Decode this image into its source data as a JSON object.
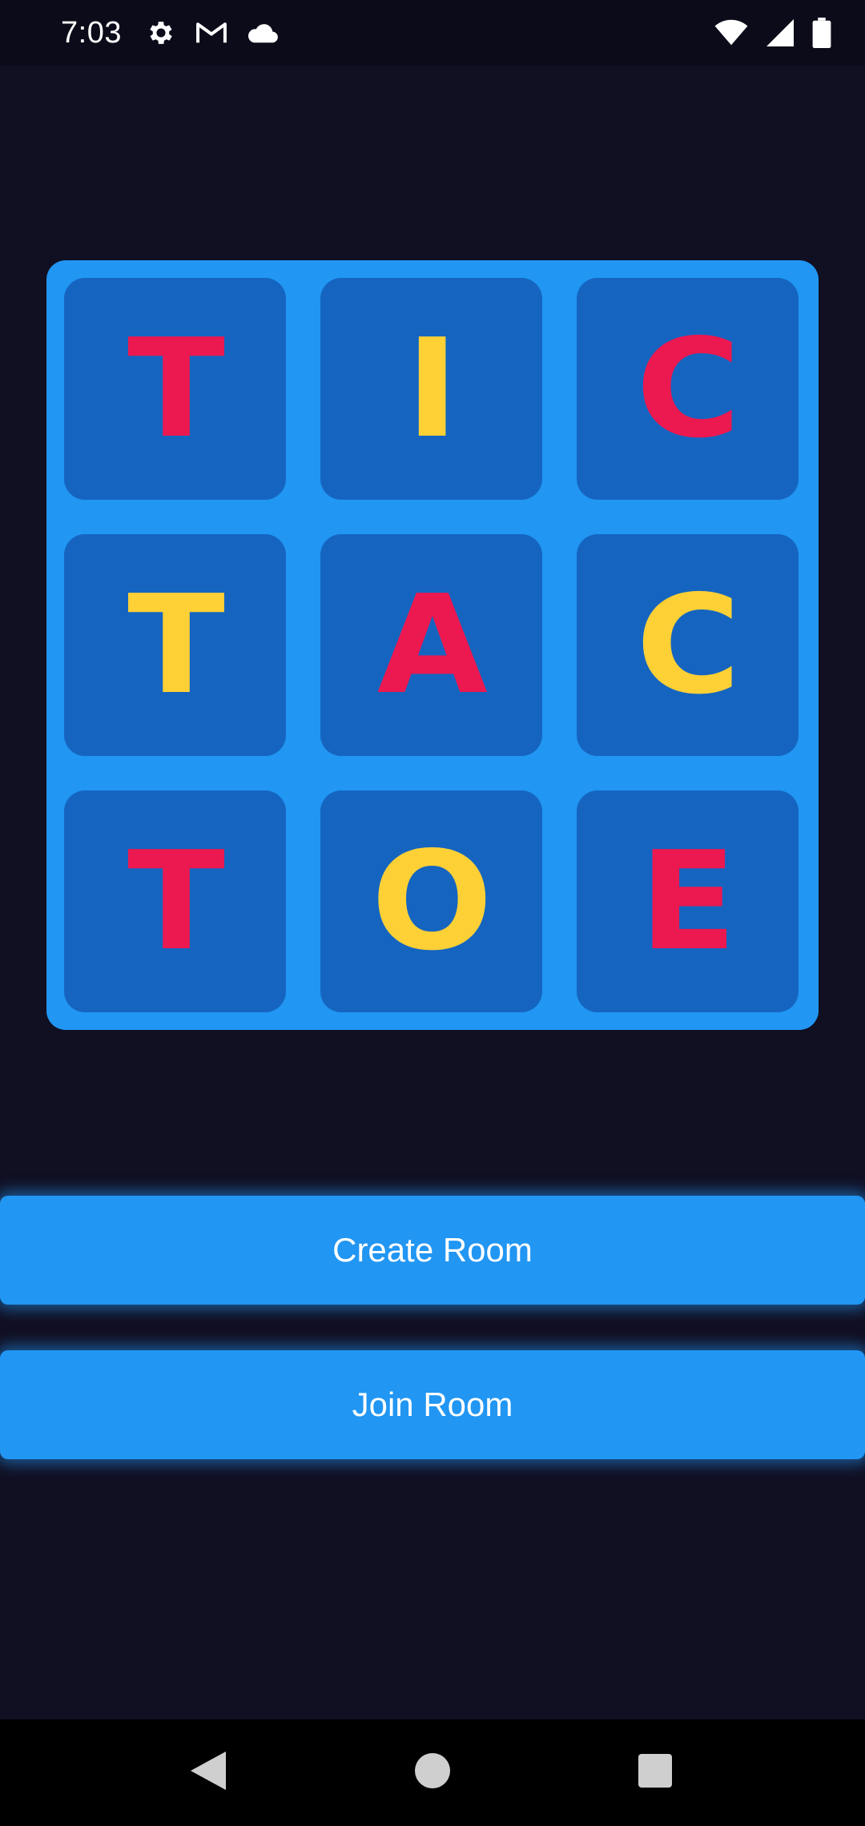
{
  "status_bar": {
    "time": "7:03",
    "left_icons": [
      "gear-icon",
      "gmail-icon",
      "cloud-icon"
    ],
    "right_icons": [
      "wifi-icon",
      "signal-icon",
      "battery-icon"
    ]
  },
  "board": {
    "cells": [
      {
        "letter": "T",
        "color": "#ec1850"
      },
      {
        "letter": "I",
        "color": "#fdd036"
      },
      {
        "letter": "C",
        "color": "#ec1850"
      },
      {
        "letter": "T",
        "color": "#fdd036"
      },
      {
        "letter": "A",
        "color": "#ec1850"
      },
      {
        "letter": "C",
        "color": "#fdd036"
      },
      {
        "letter": "T",
        "color": "#ec1850"
      },
      {
        "letter": "O",
        "color": "#fdd036"
      },
      {
        "letter": "E",
        "color": "#ec1850"
      }
    ]
  },
  "actions": {
    "create_room_label": "Create Room",
    "join_room_label": "Join Room"
  },
  "nav_bar": {
    "icons": [
      "back-icon",
      "home-icon",
      "recents-icon"
    ]
  },
  "colors": {
    "background": "#110f22",
    "accent": "#2196f3",
    "cell": "#1565c0",
    "red_letter": "#ec1850",
    "yellow_letter": "#fdd036"
  }
}
